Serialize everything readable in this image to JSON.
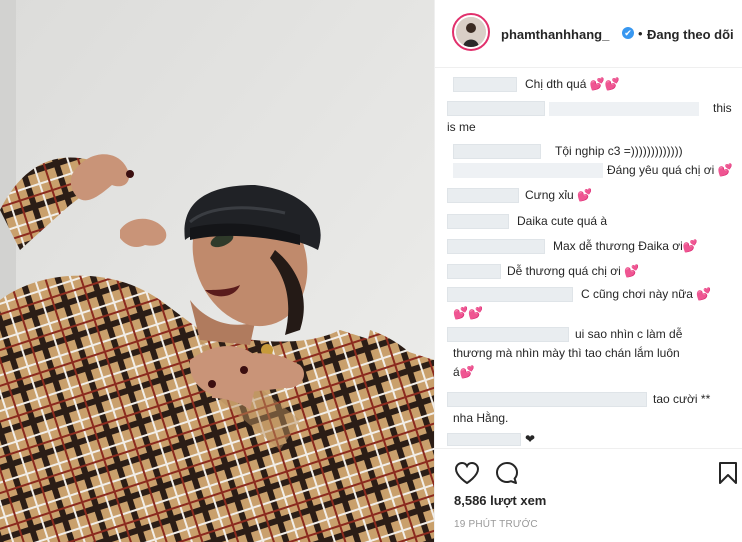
{
  "post": {
    "username": "phamthanhhang_",
    "verified_icon": "✔",
    "separator": "•",
    "follow_status": "Đang theo dõi",
    "views": "8,586 lượt xem",
    "time": "19 PHÚT TRƯỚC"
  },
  "comments": [
    {
      "text": "Chị dth quá 💕💕"
    },
    {
      "text": "this"
    },
    {
      "text": "is me"
    },
    {
      "text": "Tội nghip c3 =)))))))))))))"
    },
    {
      "text": "Đáng yêu quá chị ơi 💕"
    },
    {
      "text": "Cưng xỉu 💕"
    },
    {
      "text": "Daika cute quá à"
    },
    {
      "text": "Max dễ thương Đaika ơi💕"
    },
    {
      "text": "Dễ thương quá chị ơi 💕"
    },
    {
      "text": "C cũng chơi này nữa 💕"
    },
    {
      "text": "💕💕"
    },
    {
      "text": "ui sao nhìn c làm dễ"
    },
    {
      "text": "thương mà nhìn mày thì tao chán lắm luôn"
    },
    {
      "text": "á💕"
    },
    {
      "text": "tao cười **"
    },
    {
      "text": "nha Hằng."
    },
    {
      "text": "❤"
    }
  ],
  "icons": {
    "like": "heart-outline-icon",
    "comment": "comment-bubble-icon",
    "save": "bookmark-icon"
  }
}
